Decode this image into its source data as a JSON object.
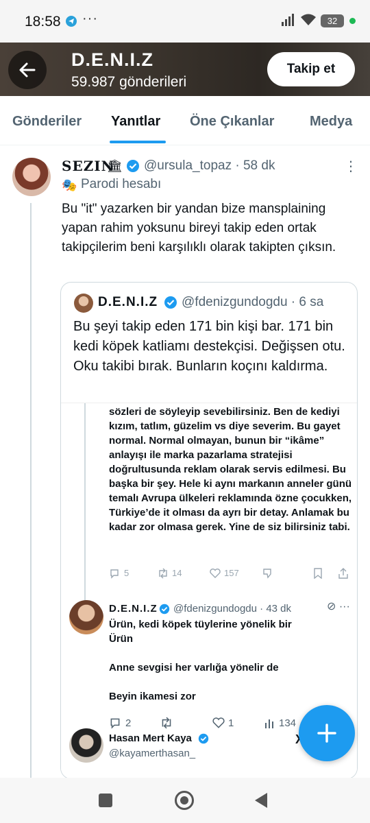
{
  "status_bar": {
    "time": "18:58",
    "dots": "···",
    "battery": "32",
    "icons": [
      "telegram-icon",
      "signal-icon",
      "wifi-icon",
      "battery-icon"
    ]
  },
  "header": {
    "name": "D.E.N.I.Z",
    "post_count": "59.987 gönderileri",
    "follow_label": "Takip et"
  },
  "tabs": [
    {
      "label": "Gönderiler"
    },
    {
      "label": "Yanıtlar"
    },
    {
      "label": "Öne Çıkanlar"
    },
    {
      "label": "Medya"
    }
  ],
  "tweet": {
    "author_name": "SEZIN",
    "author_badge": "🏛",
    "handle_time": "@ursula_topaz · 58 dk",
    "parody_label": "Parodi hesabı",
    "text": "Bu \"it\" yazarken bir yandan bize mansplaining yapan rahim yoksunu  bireyi takip eden ortak takipçilerim beni karşılıklı olarak takipten çıksın."
  },
  "quote": {
    "author_name": "D.E.N.I.Z",
    "handle_time": "@fdenizgundogdu · 6 sa",
    "text": "Bu şeyi takip eden 171 bin kişi bar. 171 bin kedi köpek katliamı destekçisi. Değişsen otu. Oku takibi bırak. Bunların koçını kaldırma."
  },
  "embedded": {
    "text": "sözleri de söyleyip sevebilirsiniz. Ben de kediyi kızım, tatlım, güzelim vs diye severim. Bu gayet normal. Normal olmayan, bunun bir “ikâme” anlayışı ile marka pazarlama stratejisi doğrultusunda reklam olarak servis edilmesi. Bu başka bir şey. Hele ki aynı markanın anneler günü temalı Avrupa ülkeleri reklamında özne çocukken, Türkiye’de it olması da ayrı bir detay. Anlamak bu kadar zor olmasa gerek. Yine de siz bilirsiniz tabi.",
    "actions": {
      "replies": "5",
      "retweets": "14",
      "likes": "157"
    },
    "reply": {
      "author_name": "D.E.N.I.Z",
      "handle_time": "@fdenizgundogdu · 43 dk",
      "line1": "Ürün, kedi köpek tüylerine yönelik bir",
      "line2": "Ürün",
      "line3": "Anne sevgisi her varlığa yönelir de",
      "line4": "Beyin ikamesi zor",
      "replies": "2",
      "likes": "1",
      "views": "134"
    },
    "next_author": {
      "name": "Hasan Mert Kaya",
      "handle": "@kayamerthasan_",
      "logo": "X"
    }
  },
  "colors": {
    "accent": "#1d9bf0",
    "text": "#0f1419",
    "secondary": "#536471"
  }
}
